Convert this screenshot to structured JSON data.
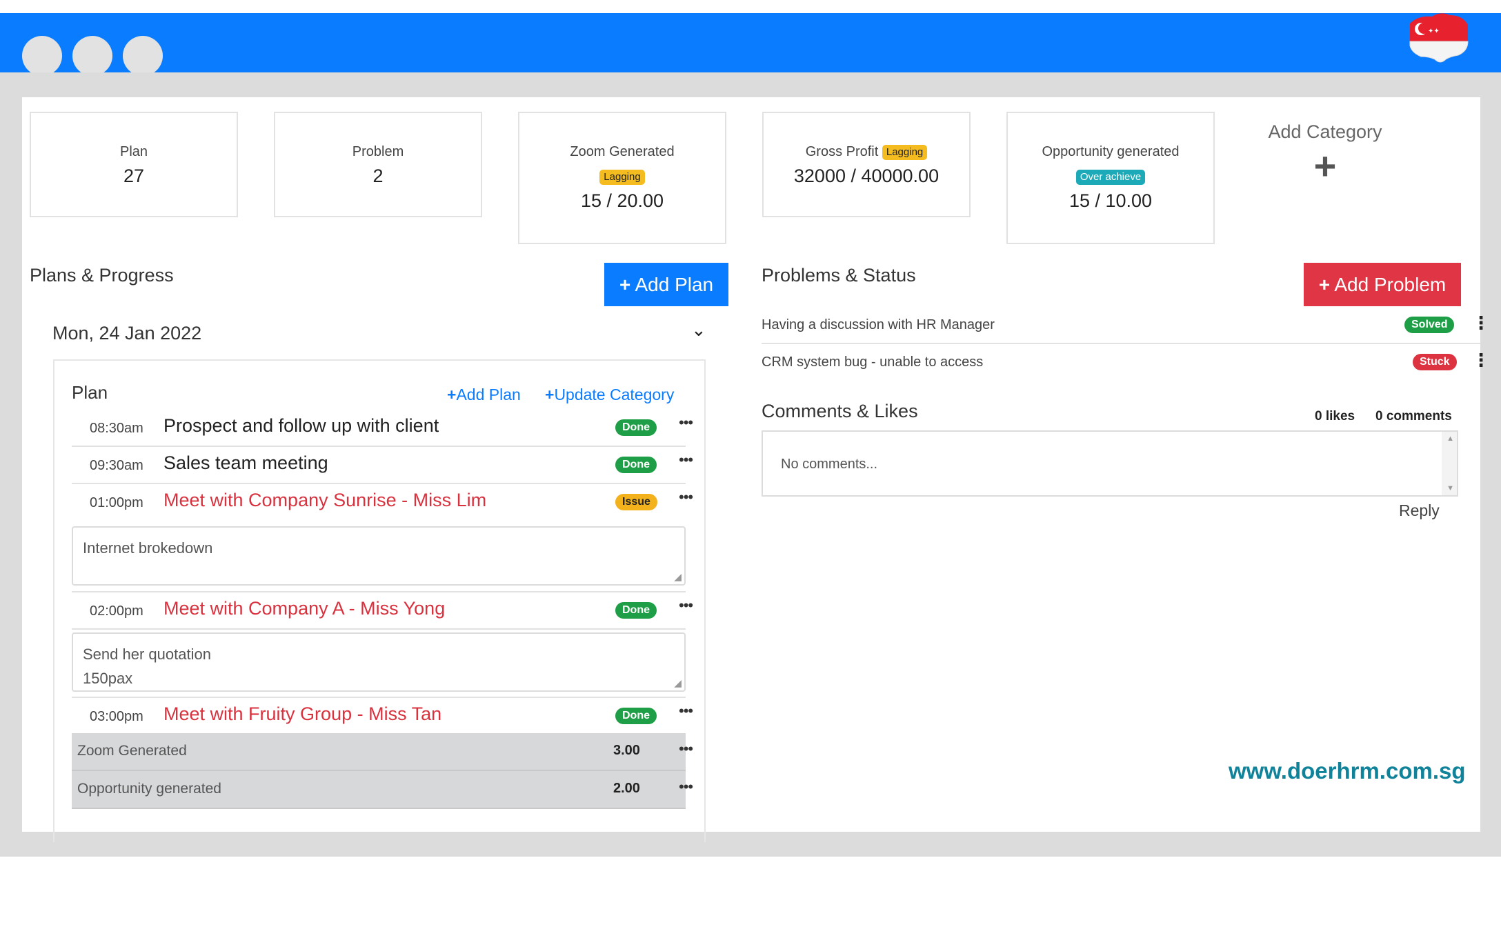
{
  "cards": [
    {
      "label": "Plan",
      "value": "27",
      "badge": ""
    },
    {
      "label": "Problem",
      "value": "2",
      "badge": ""
    },
    {
      "label": "Zoom Generated",
      "value": "15 / 20.00",
      "badge": "Lagging"
    },
    {
      "label": "Gross Profit",
      "value": "32000 / 40000.00",
      "badge": "Lagging"
    },
    {
      "label": "Opportunity generated",
      "value": "15 / 10.00",
      "badge": "Over achieve"
    }
  ],
  "add_category": {
    "label": "Add Category",
    "icon": "plus-icon"
  },
  "plans": {
    "title": "Plans & Progress",
    "add_button": "Add Plan",
    "date": "Mon, 24 Jan 2022",
    "box_title": "Plan",
    "link_add": "Add Plan",
    "link_update": "Update Category",
    "items": [
      {
        "time": "08:30am",
        "title": "Prospect and follow up with client",
        "status": "Done",
        "note": ""
      },
      {
        "time": "09:30am",
        "title": "Sales team meeting",
        "status": "Done",
        "note": ""
      },
      {
        "time": "01:00pm",
        "title": "Meet with Company Sunrise - Miss Lim",
        "status": "Issue",
        "note": "Internet brokedown"
      },
      {
        "time": "02:00pm",
        "title": "Meet with Company A - Miss Yong",
        "status": "Done",
        "note": "Send her quotation\n150pax"
      },
      {
        "time": "03:00pm",
        "title": "Meet with Fruity Group - Miss Tan",
        "status": "Done",
        "note": ""
      }
    ],
    "summary": [
      {
        "label": "Zoom Generated",
        "value": "3.00"
      },
      {
        "label": "Opportunity generated",
        "value": "2.00"
      }
    ]
  },
  "problems": {
    "title": "Problems & Status",
    "add_button": "Add Problem",
    "items": [
      {
        "text": "Having a discussion with HR Manager",
        "status": "Solved"
      },
      {
        "text": "CRM system bug - unable to access",
        "status": "Stuck"
      }
    ]
  },
  "comments": {
    "title": "Comments & Likes",
    "likes": "0 likes",
    "count": "0 comments",
    "placeholder": "No comments...",
    "reply": "Reply"
  },
  "website": "www.doerhrm.com.sg",
  "colors": {
    "brand_blue": "#0a7cff",
    "red": "#e03545",
    "green": "#1e9e46",
    "yellow": "#f3b21b",
    "teal": "#1ca9b8"
  }
}
